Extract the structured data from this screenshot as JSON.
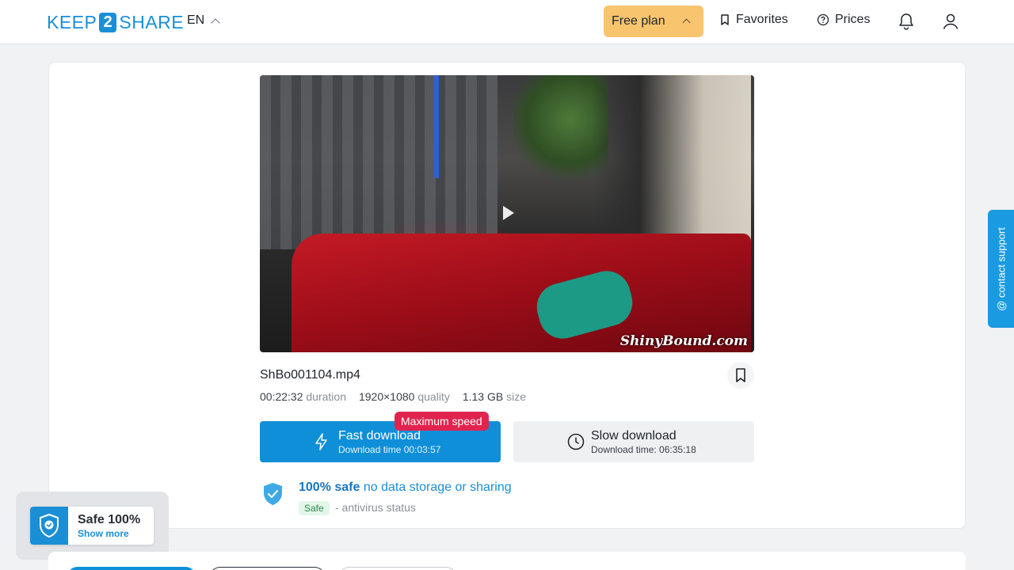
{
  "header": {
    "logo": {
      "part1": "KEEP",
      "part2": "2",
      "part3": "SHARE"
    },
    "language": "EN",
    "plan_button": "Free plan",
    "favorites": "Favorites",
    "prices": "Prices"
  },
  "file": {
    "name": "ShBo001104.mp4",
    "duration_value": "00:22:32",
    "duration_label": "duration",
    "quality_value": "1920×1080",
    "quality_label": "quality",
    "size_value": "1.13 GB",
    "size_label": "size",
    "video_watermark": "ShinyBound.com"
  },
  "downloads": {
    "fast_title": "Fast download",
    "fast_time": "Download time 00:03:57",
    "speed_badge": "Maximum speed",
    "slow_title": "Slow download",
    "slow_time": "Download time: 06:35:18"
  },
  "safety": {
    "strong": "100% safe",
    "rest": " no data storage or sharing",
    "tag": "Safe",
    "status": "- antivirus status"
  },
  "popup": {
    "title": "Safe 100%",
    "link": "Show more"
  },
  "support": {
    "label": "@ contact support"
  },
  "colors": {
    "brand": "#1a8fd6",
    "plan": "#f8c46e",
    "fast": "#0f8fd8",
    "badge": "#e0244f"
  }
}
